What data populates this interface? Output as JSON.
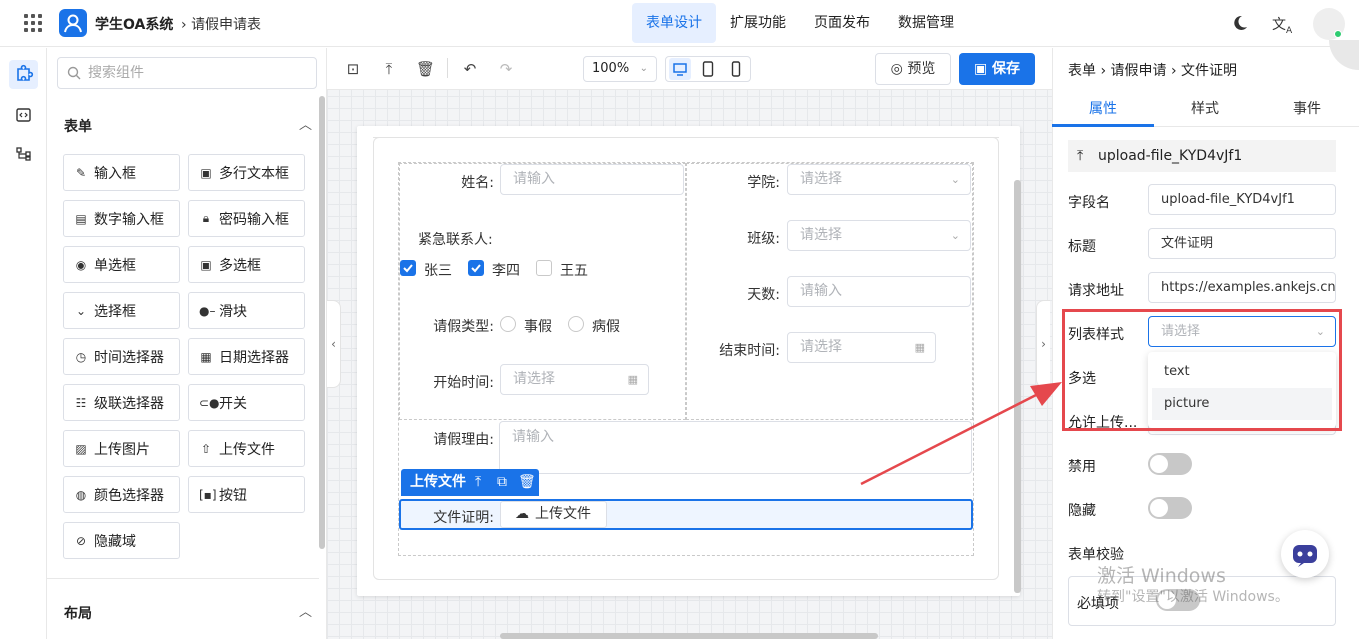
{
  "app": {
    "title": "学生OA系统",
    "breadcrumb": "请假申请表"
  },
  "topnav": [
    "表单设计",
    "扩展功能",
    "页面发布",
    "数据管理"
  ],
  "search": {
    "placeholder": "搜索组件"
  },
  "components": {
    "section_form": "表单",
    "items": [
      "输入框",
      "多行文本框",
      "数字输入框",
      "密码输入框",
      "单选框",
      "多选框",
      "选择框",
      "滑块",
      "时间选择器",
      "日期选择器",
      "级联选择器",
      "开关",
      "上传图片",
      "上传文件",
      "颜色选择器",
      "按钮",
      "隐藏域"
    ],
    "section_layout": "布局"
  },
  "toolbar": {
    "zoom": "100%",
    "preview": "预览",
    "save": "保存"
  },
  "form": {
    "name_label": "姓名:",
    "input_placeholder": "请输入",
    "select_placeholder": "请选择",
    "college_label": "学院:",
    "class_label": "班级:",
    "contact_label": "紧急联系人:",
    "contacts": [
      "张三",
      "李四",
      "王五"
    ],
    "days_label": "天数:",
    "leave_type_label": "请假类型:",
    "leave_types": [
      "事假",
      "病假"
    ],
    "end_label": "结束时间:",
    "start_label": "开始时间:",
    "reason_label": "请假理由:",
    "selected_tag": "上传文件",
    "file_label": "文件证明:",
    "upload_btn": "上传文件"
  },
  "panel": {
    "breadcrumb": [
      "表单",
      "请假申请",
      "文件证明"
    ],
    "tabs": [
      "属性",
      "样式",
      "事件"
    ],
    "component_id": "upload-file_KYD4vJf1",
    "field_name_label": "字段名",
    "field_name": "upload-file_KYD4vJf1",
    "title_label": "标题",
    "title": "文件证明",
    "url_label": "请求地址",
    "url": "https://examples.ankejs.cn,",
    "list_style_label": "列表样式",
    "list_style_placeholder": "请选择",
    "list_style_options": [
      "text",
      "picture"
    ],
    "multiple_label": "多选",
    "allow_upload_label": "允许上传...",
    "disabled_label": "禁用",
    "hidden_label": "隐藏",
    "validation_label": "表单校验",
    "required_label": "必填项"
  },
  "watermark": {
    "line1": "激活 Windows",
    "line2": "转到\"设置\"以激活 Windows。"
  },
  "colors": {
    "primary": "#1a73e8",
    "annotation": "#e5484d"
  }
}
